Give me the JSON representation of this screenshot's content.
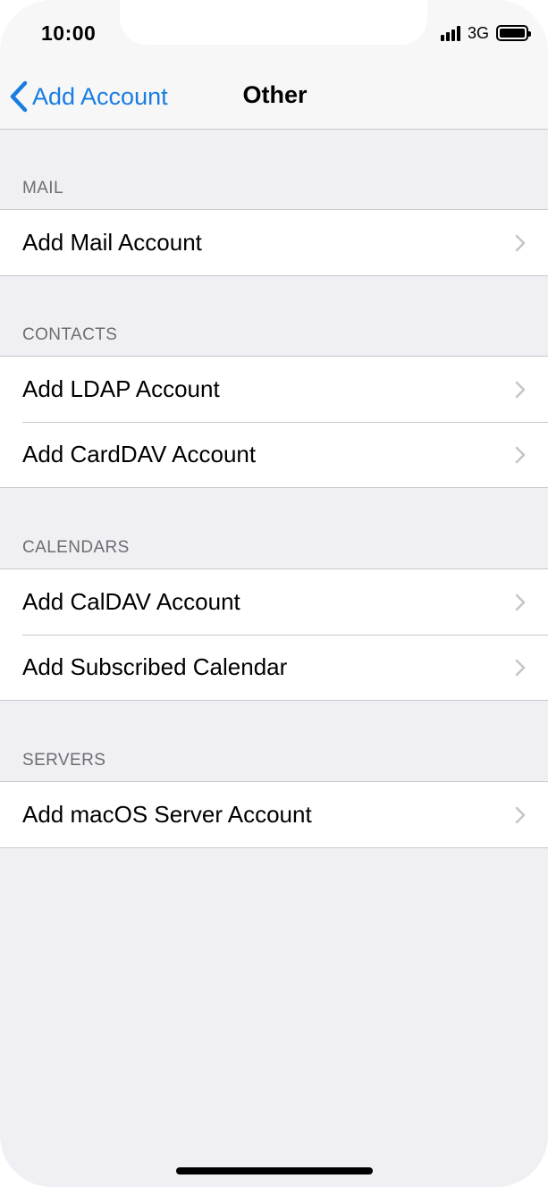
{
  "status_bar": {
    "time": "10:00",
    "network": "3G"
  },
  "nav": {
    "back_label": "Add Account",
    "title": "Other"
  },
  "sections": [
    {
      "header": "MAIL",
      "items": [
        {
          "label": "Add Mail Account"
        }
      ]
    },
    {
      "header": "CONTACTS",
      "items": [
        {
          "label": "Add LDAP Account"
        },
        {
          "label": "Add CardDAV Account"
        }
      ]
    },
    {
      "header": "CALENDARS",
      "items": [
        {
          "label": "Add CalDAV Account"
        },
        {
          "label": "Add Subscribed Calendar"
        }
      ]
    },
    {
      "header": "SERVERS",
      "items": [
        {
          "label": "Add macOS Server Account"
        }
      ]
    }
  ],
  "colors": {
    "accent": "#1a7de0",
    "background": "#efeff4",
    "separator": "#c8c7cc",
    "section_header": "#6d6d72"
  },
  "icons": {
    "back": "chevron-left-icon",
    "disclosure": "chevron-right-icon",
    "signal": "signal-icon",
    "battery": "battery-icon"
  }
}
